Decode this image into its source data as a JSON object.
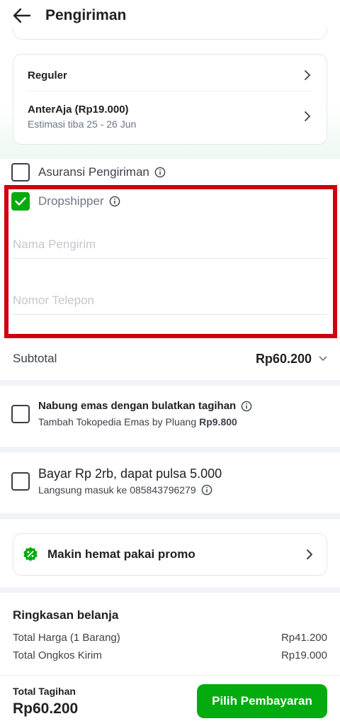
{
  "header": {
    "title": "Pengiriman",
    "back_icon": "arrow-left-icon"
  },
  "shipping": {
    "service_label": "Reguler",
    "courier_label": "AnterAja (Rp19.000)",
    "estimate": "Estimasi tiba 25 - 26 Jun"
  },
  "options": {
    "insurance_label": "Asuransi Pengiriman",
    "insurance_checked": false,
    "dropshipper_label": "Dropshipper",
    "dropshipper_checked": true
  },
  "dropshipper_form": {
    "sender_name_placeholder": "Nama Pengirim",
    "sender_name_value": "",
    "phone_placeholder": "Nomor Telepon",
    "phone_value": ""
  },
  "subtotal": {
    "label": "Subtotal",
    "value": "Rp60.200"
  },
  "gold_offer": {
    "title": "Nabung emas dengan bulatkan tagihan",
    "subtitle": "Tambah Tokopedia Emas by Pluang",
    "amount": "Rp9.800"
  },
  "pulse_offer": {
    "title": "Bayar Rp 2rb, dapat pulsa 5.000",
    "subtitle": "Langsung masuk ke 085843796279"
  },
  "promo": {
    "label": "Makin hemat pakai promo",
    "icon": "discount-badge-icon"
  },
  "summary": {
    "title": "Ringkasan belanja",
    "rows": [
      {
        "label": "Total Harga (1 Barang)",
        "value": "Rp41.200"
      },
      {
        "label": "Total Ongkos Kirim",
        "value": "Rp19.000"
      }
    ]
  },
  "footer": {
    "total_label": "Total Tagihan",
    "total_value": "Rp60.200",
    "pay_button": "Pilih Pembayaran"
  },
  "colors": {
    "accent_green": "#03ac0e",
    "highlight_red": "#d0000c"
  }
}
